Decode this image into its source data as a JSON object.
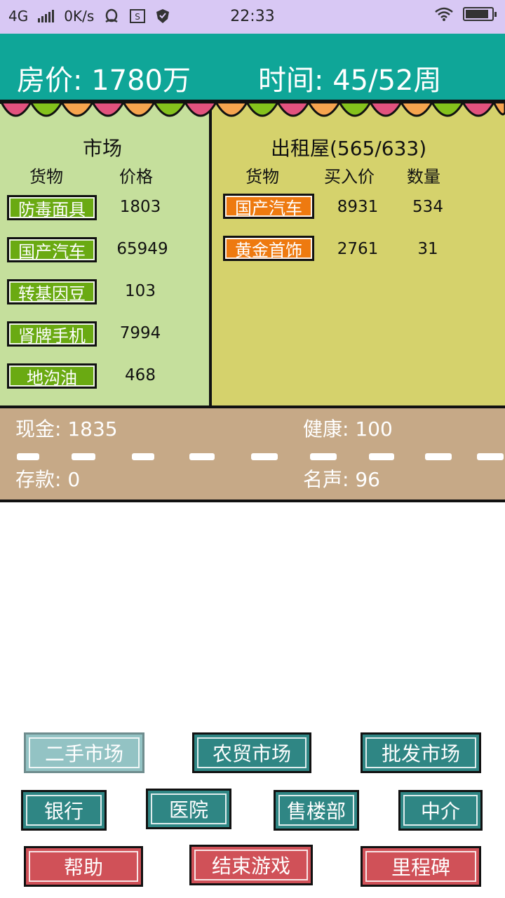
{
  "status_bar": {
    "network": "4G",
    "speed": "0K/s",
    "time": "22:33",
    "icons": [
      "signal-icon",
      "qq-icon",
      "sim-icon",
      "shield-icon",
      "wifi-icon",
      "battery-icon"
    ],
    "battery_level": 0.9
  },
  "header": {
    "price_text": "房价: 1780万",
    "time_text": "时间: 45/52周"
  },
  "market": {
    "title": "市场",
    "col_goods": "货物",
    "col_price": "价格",
    "items": [
      {
        "name": "防毒面具",
        "price": "1803"
      },
      {
        "name": "国产汽车",
        "price": "65949"
      },
      {
        "name": "转基因豆",
        "price": "103"
      },
      {
        "name": "肾牌手机",
        "price": "7994"
      },
      {
        "name": "地沟油",
        "price": "468"
      }
    ]
  },
  "rental": {
    "title": "出租屋(565/633)",
    "col_goods": "货物",
    "col_buy_price": "买入价",
    "col_qty": "数量",
    "items": [
      {
        "name": "国产汽车",
        "buy_price": "8931",
        "qty": "534"
      },
      {
        "name": "黄金首饰",
        "buy_price": "2761",
        "qty": "31"
      }
    ]
  },
  "stats": {
    "cash": "现金: 1835",
    "health": "健康: 100",
    "deposit": "存款: 0",
    "fame": "名声: 96"
  },
  "buttons": {
    "second_hand": "二手市场",
    "farm_market": "农贸市场",
    "wholesale": "批发市场",
    "bank": "银行",
    "hospital": "医院",
    "sales_office": "售楼部",
    "agency": "中介",
    "help": "帮助",
    "end_game": "结束游戏",
    "milestone": "里程碑"
  },
  "colors": {
    "header_bg": "#0fa698",
    "market_bg": "#c5df9c",
    "rent_bg": "#d5d26c",
    "stats_bg": "#c6a987",
    "market_item": "#6aaa12",
    "rent_item": "#ee7a10",
    "button_teal": "#2f8684",
    "button_red": "#d05158"
  }
}
